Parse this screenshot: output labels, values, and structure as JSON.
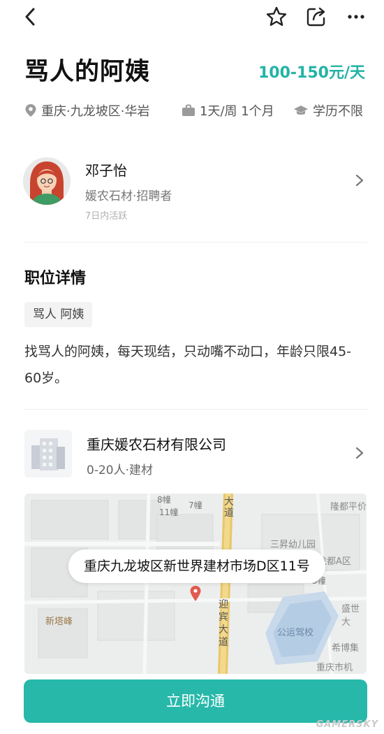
{
  "job": {
    "title": "骂人的阿姨",
    "salary": "100-150元/天",
    "location": "重庆·九龙坡区·华岩",
    "schedule": "1天/周 1个月",
    "education": "学历不限"
  },
  "recruiter": {
    "name": "邓子怡",
    "role": "媛农石材·招聘者",
    "active": "7日内活跃"
  },
  "details": {
    "section_title": "职位详情",
    "tag": "骂人 阿姨",
    "description": "找骂人的阿姨，每天现结，只动嘴不动口，年龄只限45-60岁。"
  },
  "company": {
    "name": "重庆媛农石材有限公司",
    "info": "0-20人·建材"
  },
  "map": {
    "address": "重庆九龙坡区新世界建材市场D区11号",
    "labels": {
      "l8": "8幢",
      "l7": "7幢",
      "l11": "11幢",
      "l3": "3幢",
      "road1": "大道",
      "road2": "迎宾大道",
      "kinder": "三昇幼儿园",
      "longdu": "龙都A区",
      "jiangdu": "隆都平价",
      "shengshi": "盛世大",
      "gongyun": "公运驾校",
      "xibo": "希博集",
      "xintafeng": "新塔峰",
      "chongqing": "重庆市机"
    }
  },
  "actions": {
    "contact": "立即沟通"
  },
  "watermark": "GAMERSKY",
  "colors": {
    "accent": "#27b8aa",
    "salary": "#23b3a6"
  },
  "icons": [
    "back-icon",
    "star-icon",
    "share-icon",
    "more-icon",
    "location-icon",
    "briefcase-icon",
    "education-icon",
    "chevron-right-icon",
    "building-icon",
    "map-pin-icon"
  ]
}
